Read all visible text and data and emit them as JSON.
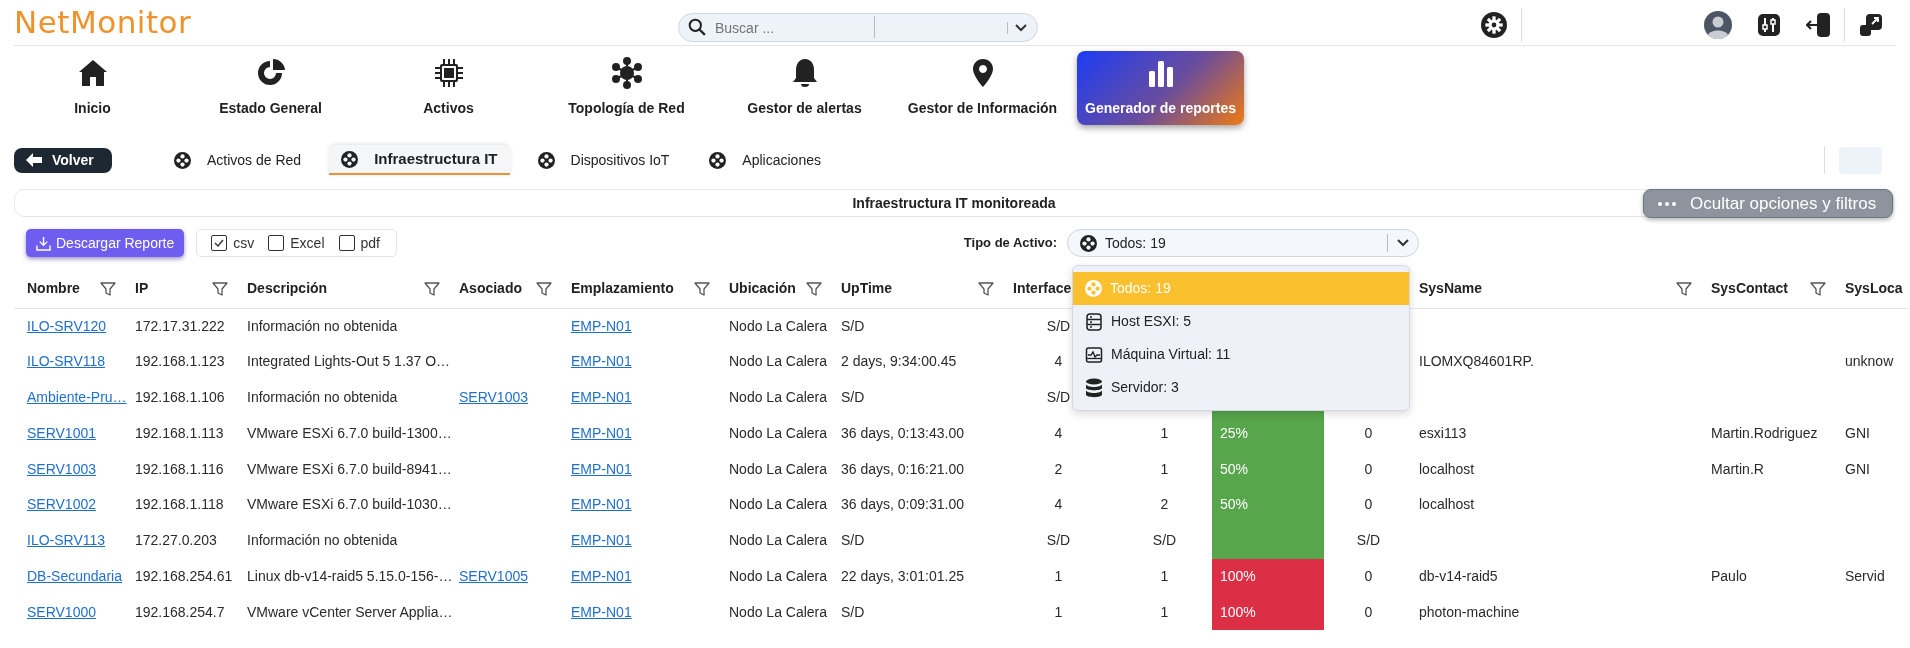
{
  "header": {
    "logo": "NetMonitor",
    "search": {
      "placeholder": "Buscar ..."
    }
  },
  "nav": [
    {
      "label": "Inicio",
      "kind": "house",
      "selected": false
    },
    {
      "label": "Estado General",
      "kind": "donut",
      "selected": false
    },
    {
      "label": "Activos",
      "kind": "chip",
      "selected": false
    },
    {
      "label": "Topología de Red",
      "kind": "network",
      "selected": false
    },
    {
      "label": "Gestor de alertas",
      "kind": "bell",
      "selected": false
    },
    {
      "label": "Gestor de Información",
      "kind": "pin",
      "selected": false
    },
    {
      "label": "Generador de reportes",
      "kind": "bars",
      "selected": true
    }
  ],
  "back_button": "Volver",
  "tabs": [
    {
      "label": "Activos de Red",
      "selected": false
    },
    {
      "label": "Infraestructura IT",
      "selected": true
    },
    {
      "label": "Dispositivos IoT",
      "selected": false
    },
    {
      "label": "Aplicaciones",
      "selected": false
    }
  ],
  "title": "Infraestructura IT monitoreada",
  "toggle_button": "Ocultar opciones y filtros",
  "download_button": "Descargar Reporte",
  "formats": [
    {
      "label": "csv",
      "checked": true
    },
    {
      "label": "Excel",
      "checked": false
    },
    {
      "label": "pdf",
      "checked": false
    }
  ],
  "asset_type": {
    "label": "Tipo de Activo:",
    "value": "Todos: 19",
    "expanded": true,
    "options": [
      {
        "label": "Todos: 19",
        "kind": "all",
        "selected": true
      },
      {
        "label": "Host ESXI: 5",
        "kind": "host",
        "selected": false
      },
      {
        "label": "Máquina Virtual: 11",
        "kind": "vm",
        "selected": false
      },
      {
        "label": "Servidor: 3",
        "kind": "server",
        "selected": false
      }
    ]
  },
  "table": {
    "columns": [
      {
        "label": "Nombre",
        "filter": true
      },
      {
        "label": "IP",
        "filter": true
      },
      {
        "label": "Descripción",
        "filter": true
      },
      {
        "label": "Asociado",
        "filter": true
      },
      {
        "label": "Emplazamiento",
        "filter": true
      },
      {
        "label": "Ubicación",
        "filter": true
      },
      {
        "label": "UpTime",
        "filter": true
      },
      {
        "label": "Interface",
        "filter": false
      },
      {},
      {},
      {},
      {
        "label": "SysName",
        "filter": true
      },
      {
        "label": "SysContact",
        "filter": true
      },
      {
        "label": "SysLoca",
        "filter": false
      }
    ],
    "rows": [
      {
        "nombre": "ILO-SRV120",
        "ip": "172.17.31.222",
        "descripcion": "Información no obtenida",
        "emplazamiento": "EMP-N01",
        "ubicacion": "Nodo La Calera",
        "uptime": "S/D",
        "interface": "S/D"
      },
      {
        "nombre": "ILO-SRV118",
        "ip": "192.168.1.123",
        "descripcion": "Integrated Lights-Out 5 1.37 O…",
        "emplazamiento": "EMP-N01",
        "ubicacion": "Nodo La Calera",
        "uptime": "2 days, 9:34:00.45",
        "interface": "4",
        "sysname": "ILOMXQ84601RP.",
        "sysloca": "unknow"
      },
      {
        "nombre": "Ambiente-Pru…",
        "ip": "192.168.1.106",
        "descripcion": "Información no obtenida",
        "asociado": "SERV1003",
        "emplazamiento": "EMP-N01",
        "ubicacion": "Nodo La Calera",
        "uptime": "S/D",
        "interface": "S/D",
        "column_10": {
          "color": "#57a64b"
        }
      },
      {
        "nombre": "SERV1001",
        "ip": "192.168.1.113",
        "descripcion": "VMware ESXi 6.7.0 build-1300…",
        "emplazamiento": "EMP-N01",
        "ubicacion": "Nodo La Calera",
        "uptime": "36 days, 0:13:43.00",
        "interface": "4",
        "column_9": "1",
        "column_10": {
          "text": "25%",
          "color": "#57a64b"
        },
        "column_11": "0",
        "sysname": "esxi113",
        "syscontact": "Martin.Rodriguez",
        "sysloca": "GNI"
      },
      {
        "nombre": "SERV1003",
        "ip": "192.168.1.116",
        "descripcion": "VMware ESXi 6.7.0 build-8941…",
        "emplazamiento": "EMP-N01",
        "ubicacion": "Nodo La Calera",
        "uptime": "36 days, 0:16:21.00",
        "interface": "2",
        "column_9": "1",
        "column_10": {
          "text": "50%",
          "color": "#57a64b"
        },
        "column_11": "0",
        "sysname": "localhost",
        "syscontact": "Martin.R",
        "sysloca": "GNI"
      },
      {
        "nombre": "SERV1002",
        "ip": "192.168.1.118",
        "descripcion": "VMware ESXi 6.7.0 build-1030…",
        "emplazamiento": "EMP-N01",
        "ubicacion": "Nodo La Calera",
        "uptime": "36 days, 0:09:31.00",
        "interface": "4",
        "column_9": "2",
        "column_10": {
          "text": "50%",
          "color": "#57a64b"
        },
        "column_11": "0",
        "sysname": "localhost"
      },
      {
        "nombre": "ILO-SRV113",
        "ip": "172.27.0.203",
        "descripcion": "Información no obtenida",
        "emplazamiento": "EMP-N01",
        "ubicacion": "Nodo La Calera",
        "uptime": "S/D",
        "interface": "S/D",
        "column_9": "S/D",
        "column_10": {
          "color": "#57a64b"
        },
        "column_11": "S/D"
      },
      {
        "nombre": "DB-Secundaria",
        "ip": "192.168.254.61",
        "descripcion": "Linux db-v14-raid5 5.15.0-156-…",
        "asociado": "SERV1005",
        "emplazamiento": "EMP-N01",
        "ubicacion": "Nodo La Calera",
        "uptime": "22 days, 3:01:01.25",
        "interface": "1",
        "column_9": "1",
        "column_10": {
          "text": "100%",
          "color": "#dc2f45"
        },
        "column_11": "0",
        "sysname": "db-v14-raid5",
        "syscontact": "Paulo",
        "sysloca": "Servid"
      },
      {
        "nombre": "SERV1000",
        "ip": "192.168.254.7",
        "descripcion": "VMware vCenter Server Applia…",
        "emplazamiento": "EMP-N01",
        "ubicacion": "Nodo La Calera",
        "uptime": "S/D",
        "interface": "1",
        "column_9": "1",
        "column_10": {
          "text": "100%",
          "color": "#dc2f45"
        },
        "column_11": "0",
        "sysname": "photon-machine"
      }
    ]
  }
}
